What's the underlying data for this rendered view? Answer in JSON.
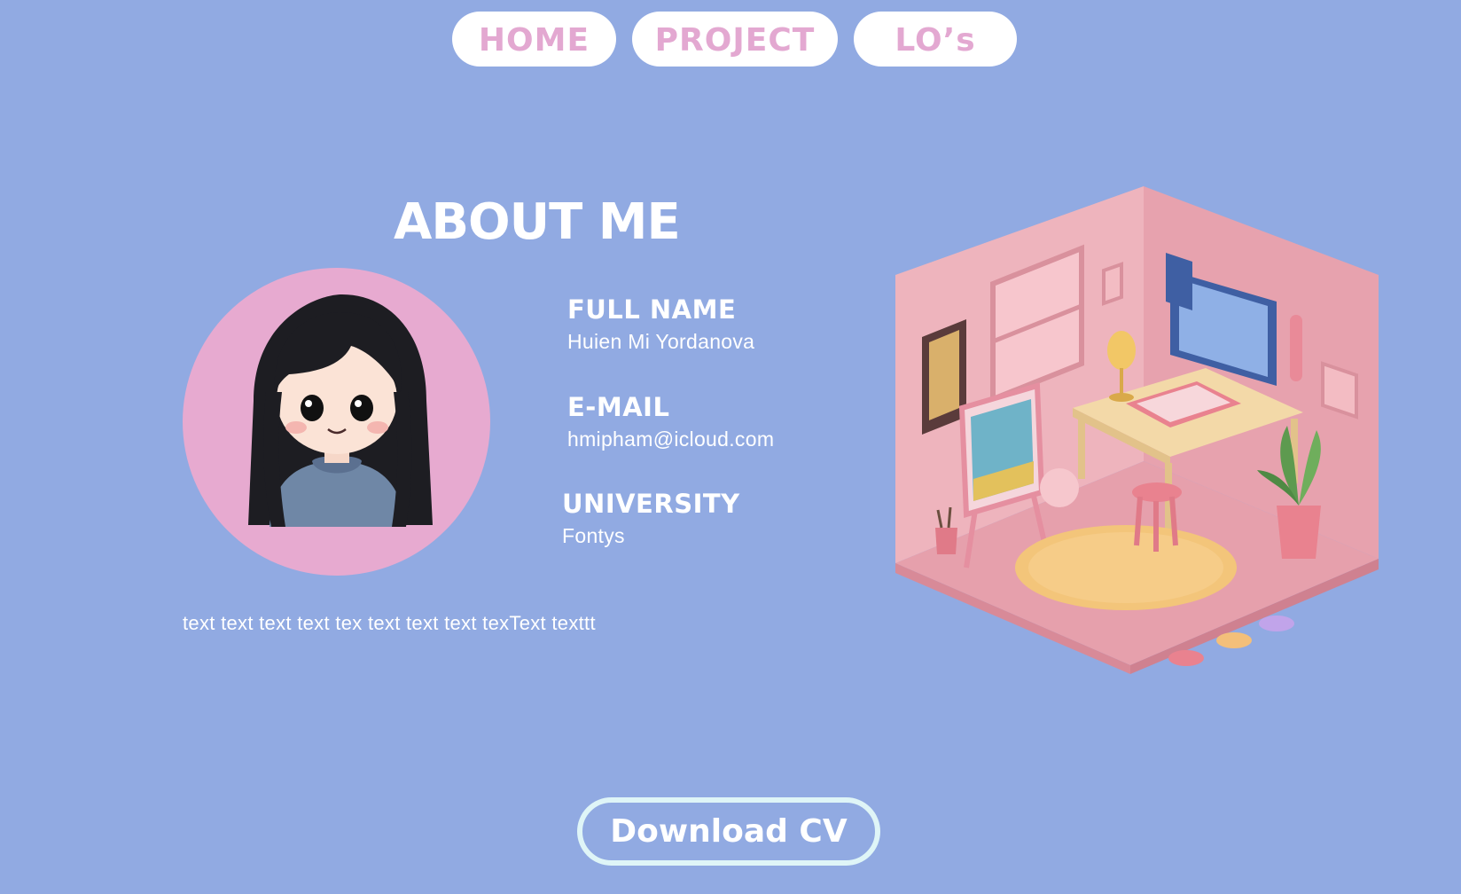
{
  "nav": {
    "items": [
      {
        "label": "HOME"
      },
      {
        "label": "PROJECT"
      },
      {
        "label": "LO’s"
      }
    ]
  },
  "about": {
    "title": "ABOUT ME",
    "full_name": {
      "label": "FULL NAME",
      "value": "Huien Mi Yordanova"
    },
    "email": {
      "label": "E-MAIL",
      "value": "hmipham@icloud.com"
    },
    "university": {
      "label": "UNIVERSITY",
      "value": "Fontys"
    },
    "bio": "text text text text tex text text text texText texttt"
  },
  "cta": {
    "download_label": "Download CV"
  },
  "colors": {
    "background": "#91aae2",
    "nav_text": "#e3a8d1",
    "avatar_bg": "#e7aad0",
    "room_pink": "#e8a3ae",
    "button_border": "#dff5f7"
  }
}
